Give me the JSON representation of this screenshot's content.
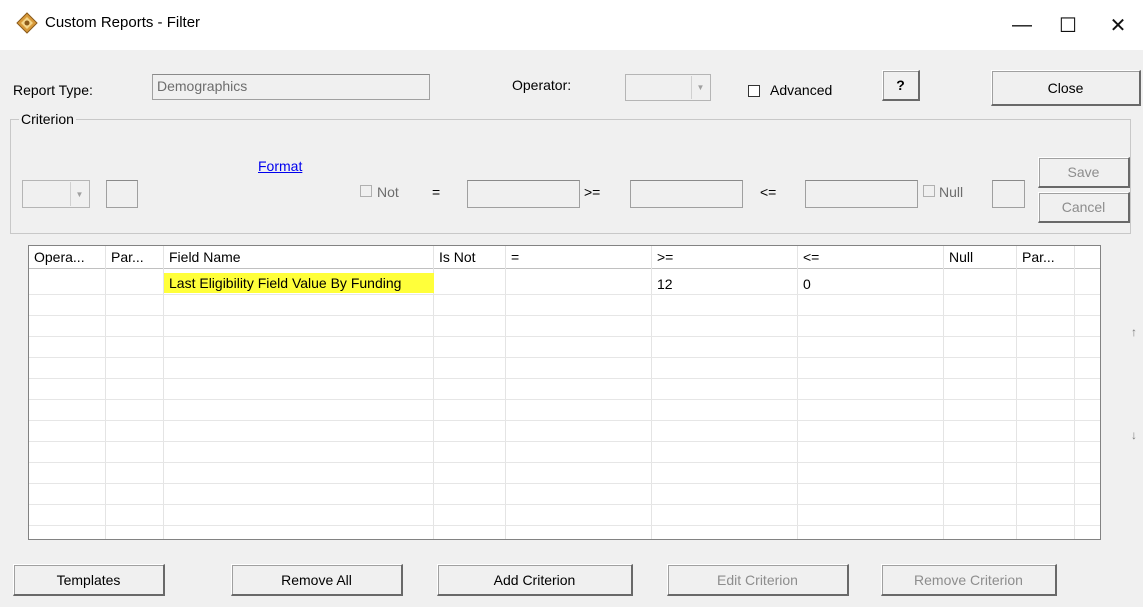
{
  "window": {
    "title": "Custom Reports - Filter",
    "minimize": "—",
    "maximize": "☐",
    "close": "✕"
  },
  "top": {
    "report_type_label": "Report Type:",
    "report_type_value": "Demographics",
    "operator_label": "Operator:",
    "operator_value": "",
    "advanced_label": "Advanced",
    "help_label": "?",
    "close_label": "Close"
  },
  "criterion": {
    "group_label": "Criterion",
    "format_link": "Format",
    "not_label": "Not",
    "eq_label": "=",
    "ge_label": ">=",
    "le_label": "<=",
    "null_label": "Null",
    "save_label": "Save",
    "cancel_label": "Cancel"
  },
  "table": {
    "columns": [
      "Opera...",
      "Par...",
      "Field Name",
      "Is Not",
      "=",
      ">=",
      "<=",
      "Null",
      "Par..."
    ],
    "rows": [
      {
        "operator": "",
        "paren_open": "",
        "field_name": "Last Eligibility Field Value By Funding",
        "is_not": "",
        "eq": "",
        "ge": "12",
        "le": "0",
        "null": "",
        "paren_close": ""
      }
    ],
    "up_arrow": "↑",
    "down_arrow": "↓"
  },
  "bottom": {
    "templates_label": "Templates",
    "remove_all_label": "Remove All",
    "add_criterion_label": "Add Criterion",
    "edit_criterion_label": "Edit Criterion",
    "remove_criterion_label": "Remove Criterion"
  }
}
